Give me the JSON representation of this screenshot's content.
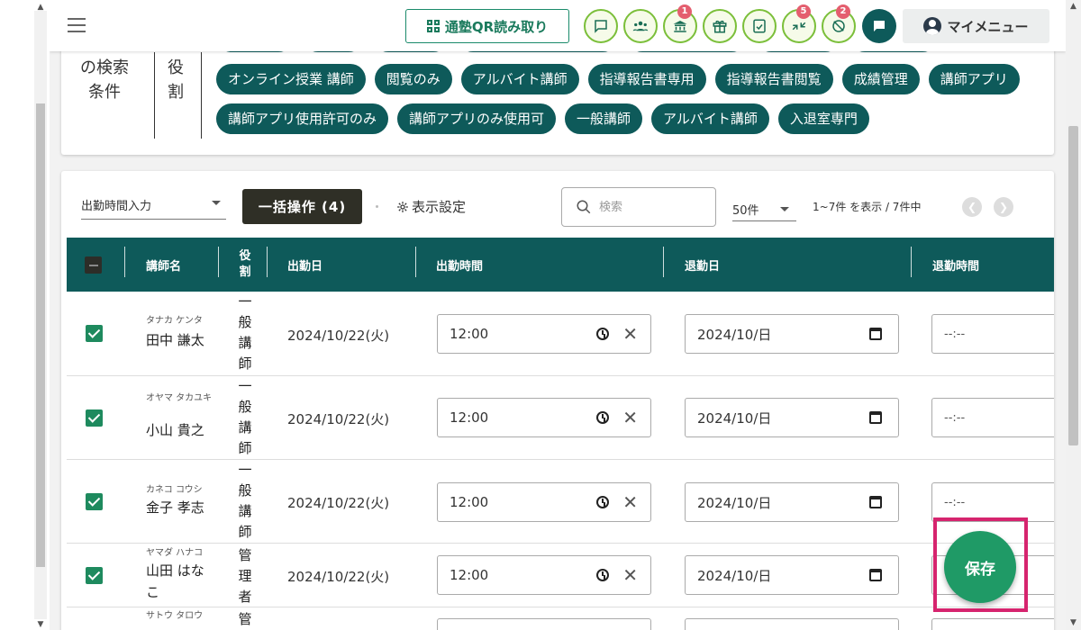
{
  "header": {
    "qr_button_label": "通塾QR読み取り",
    "badges": {
      "school": "1",
      "transfer": "5",
      "location_off": "2"
    },
    "my_menu_label": "マイメニュー"
  },
  "search_conditions": {
    "label": "の検索条件",
    "role_label": "役割",
    "chips_row1": [
      "オンライン授業 講師",
      "閲覧のみ",
      "アルバイト講師",
      "指導報告書専用",
      "指導報告書閲覧",
      "成績管理",
      "講師アプリ"
    ],
    "chips_row2": [
      "講師アプリ使用許可のみ",
      "講師アプリのみ使用可",
      "一般講師",
      "アルバイト講師",
      "入退室専門"
    ]
  },
  "toolbar": {
    "input_mode": "出勤時間入力",
    "bulk_action": "一括操作 (4)",
    "display_settings": "表示設定",
    "search_placeholder": "検索",
    "per_page": "50件",
    "range_text": "1~7件 を表示 / 7件中"
  },
  "table": {
    "headers": {
      "teacher_name": "講師名",
      "role": "役割",
      "clock_in_date": "出勤日",
      "clock_in_time": "出勤時間",
      "clock_out_date": "退勤日",
      "clock_out_time": "退勤時間"
    },
    "rows": [
      {
        "kana": "タナカ ケンタ",
        "name": "田中 謙太",
        "role": "一般講師",
        "date": "2024/10/22(火)",
        "time_in": "12:00",
        "date_out": "2024/10/日",
        "time_out": "--:--"
      },
      {
        "kana": "オヤマ タカユキ",
        "name": "小山 貴之",
        "role": "一般講師",
        "date": "2024/10/22(火)",
        "time_in": "12:00",
        "date_out": "2024/10/日",
        "time_out": "--:--"
      },
      {
        "kana": "カネコ コウシ",
        "name": "金子 孝志",
        "role": "一般講師",
        "date": "2024/10/22(火)",
        "time_in": "12:00",
        "date_out": "2024/10/日",
        "time_out": "--:--"
      },
      {
        "kana": "ヤマダ ハナコ",
        "name": "山田 はなこ",
        "role": "管理者",
        "date": "2024/10/22(火)",
        "time_in": "12:00",
        "date_out": "2024/10/日",
        "time_out": ""
      },
      {
        "kana": "サトウ タロウ",
        "name": "",
        "role": "管",
        "date": "",
        "time_in": "",
        "date_out": "",
        "time_out": ""
      }
    ]
  },
  "save_button_label": "保存",
  "colors": {
    "primary": "#0e5a5a",
    "accent_green": "#1f9a66",
    "highlight": "#d6246e",
    "badge": "#e45e6e"
  }
}
